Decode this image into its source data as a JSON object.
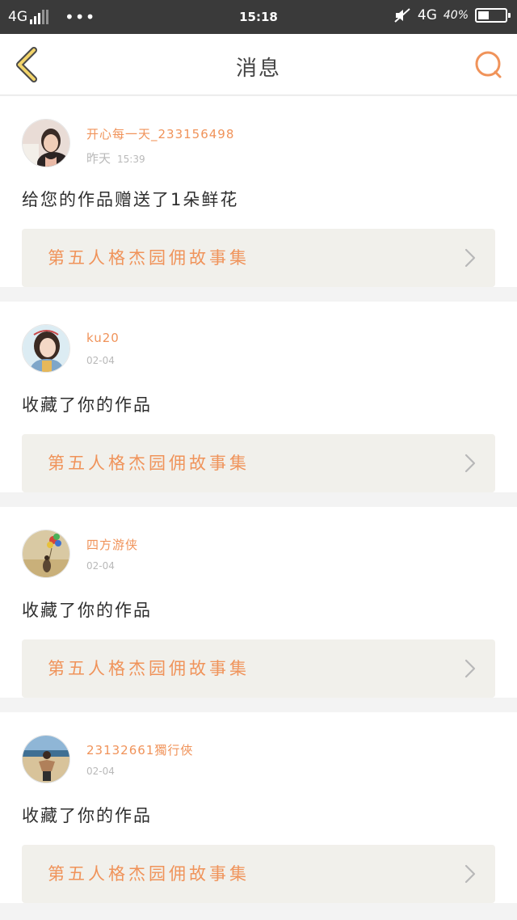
{
  "status_bar": {
    "network_left": "4G",
    "dots": "•••",
    "time": "15:18",
    "network_right": "4G",
    "battery_percent": "40%",
    "battery_level": 0.4,
    "icons": [
      "signal-bars-icon",
      "mute-icon",
      "battery-icon"
    ]
  },
  "header": {
    "title": "消息",
    "back_icon": "back-chevron-icon",
    "search_icon": "search-icon"
  },
  "colors": {
    "accent": "#f0935a",
    "status_bar_bg": "#3a3a3a",
    "work_box_bg": "#f1f0eb",
    "page_bg": "#f3f3f3"
  },
  "messages": [
    {
      "user": "开心每一天_233156498",
      "day": "昨天",
      "time": "15:39",
      "action": "给您的作品赠送了1朵鲜花",
      "work_title": "第五人格杰园佣故事集"
    },
    {
      "user": "ku20",
      "day": "",
      "time": "02-04",
      "action": "收藏了你的作品",
      "work_title": "第五人格杰园佣故事集"
    },
    {
      "user": "四方游侠",
      "day": "",
      "time": "02-04",
      "action": "收藏了你的作品",
      "work_title": "第五人格杰园佣故事集"
    },
    {
      "user": "23132661獨行俠",
      "day": "",
      "time": "02-04",
      "action": "收藏了你的作品",
      "work_title": "第五人格杰园佣故事集"
    }
  ]
}
